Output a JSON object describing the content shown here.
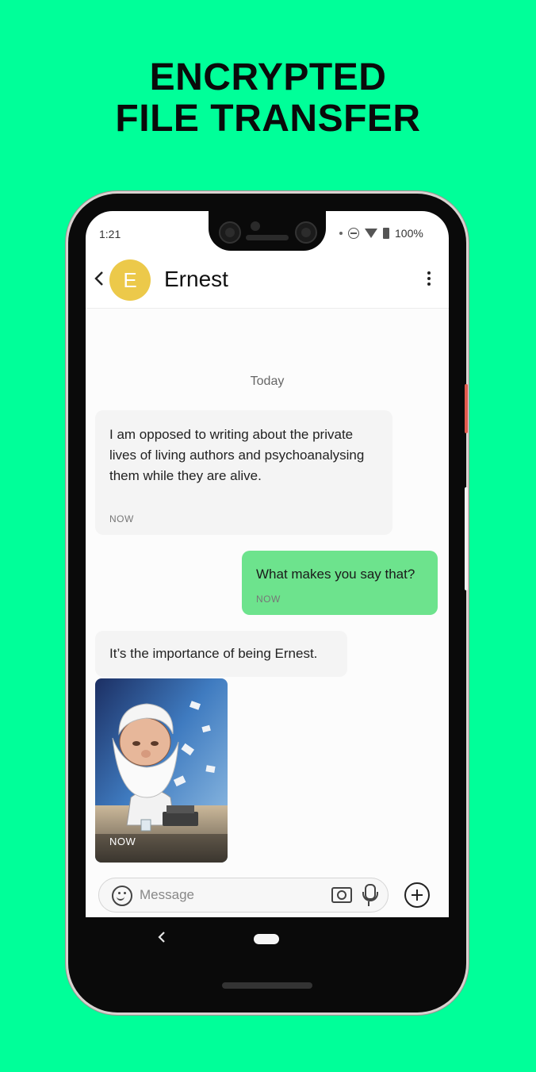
{
  "headline": {
    "line1": "ENCRYPTED",
    "line2": "FILE TRANSFER"
  },
  "status_bar": {
    "time": "1:21",
    "battery": "100%"
  },
  "header": {
    "back_icon": "back-chevron-icon",
    "avatar_letter": "E",
    "contact_name": "Ernest",
    "menu_icon": "more-vert-icon"
  },
  "chat": {
    "date_separator": "Today",
    "messages": [
      {
        "direction": "incoming",
        "text": "I am opposed to writing about the private lives of living authors and psychoanalysing them while they are alive.",
        "time": "NOW"
      },
      {
        "direction": "outgoing",
        "text": "What makes you say that?",
        "time": "NOW"
      },
      {
        "direction": "incoming",
        "text": "It’s the importance of being Ernest.",
        "time": ""
      },
      {
        "direction": "incoming",
        "type": "image",
        "time": "NOW"
      }
    ]
  },
  "composer": {
    "placeholder": "Message",
    "icons": [
      "emoji-icon",
      "camera-icon",
      "mic-icon",
      "add-icon"
    ]
  },
  "colors": {
    "background": "#00ff99",
    "outgoing_bubble": "#6de38d",
    "incoming_bubble": "#f4f4f4",
    "avatar": "#ecc94a"
  }
}
